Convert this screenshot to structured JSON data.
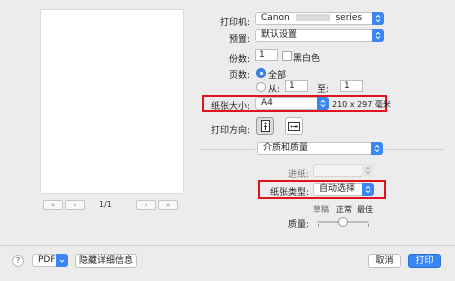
{
  "preview": {
    "page_indicator": "1/1"
  },
  "printer": {
    "label": "打印机:",
    "brand": "Canon",
    "model": "series"
  },
  "presets": {
    "label": "预置:",
    "value": "默认设置"
  },
  "copies": {
    "label": "份数:",
    "value": "1",
    "bw_label": "黑白色"
  },
  "pages": {
    "label": "页数:",
    "all_label": "全部",
    "from_label": "从:",
    "from_value": "1",
    "to_label": "至:",
    "to_value": "1"
  },
  "paper_size": {
    "label": "纸张大小:",
    "value": "A4",
    "dimensions": "210 x 297 毫米"
  },
  "orientation": {
    "label": "打印方向:"
  },
  "section": {
    "value": "介质和质量"
  },
  "feed": {
    "label": "进纸:"
  },
  "media_type": {
    "label": "纸张类型:",
    "value": "自动选择"
  },
  "quality": {
    "label": "质量:",
    "draft": "草稿",
    "standard": "正常",
    "high": "最佳"
  },
  "footer": {
    "help": "?",
    "pdf_label": "PDF",
    "hide_details": "隐藏详细信息",
    "cancel": "取消",
    "print": "打印"
  },
  "colors": {
    "accent": "#3a86f5",
    "highlight_border": "#e0141e"
  }
}
